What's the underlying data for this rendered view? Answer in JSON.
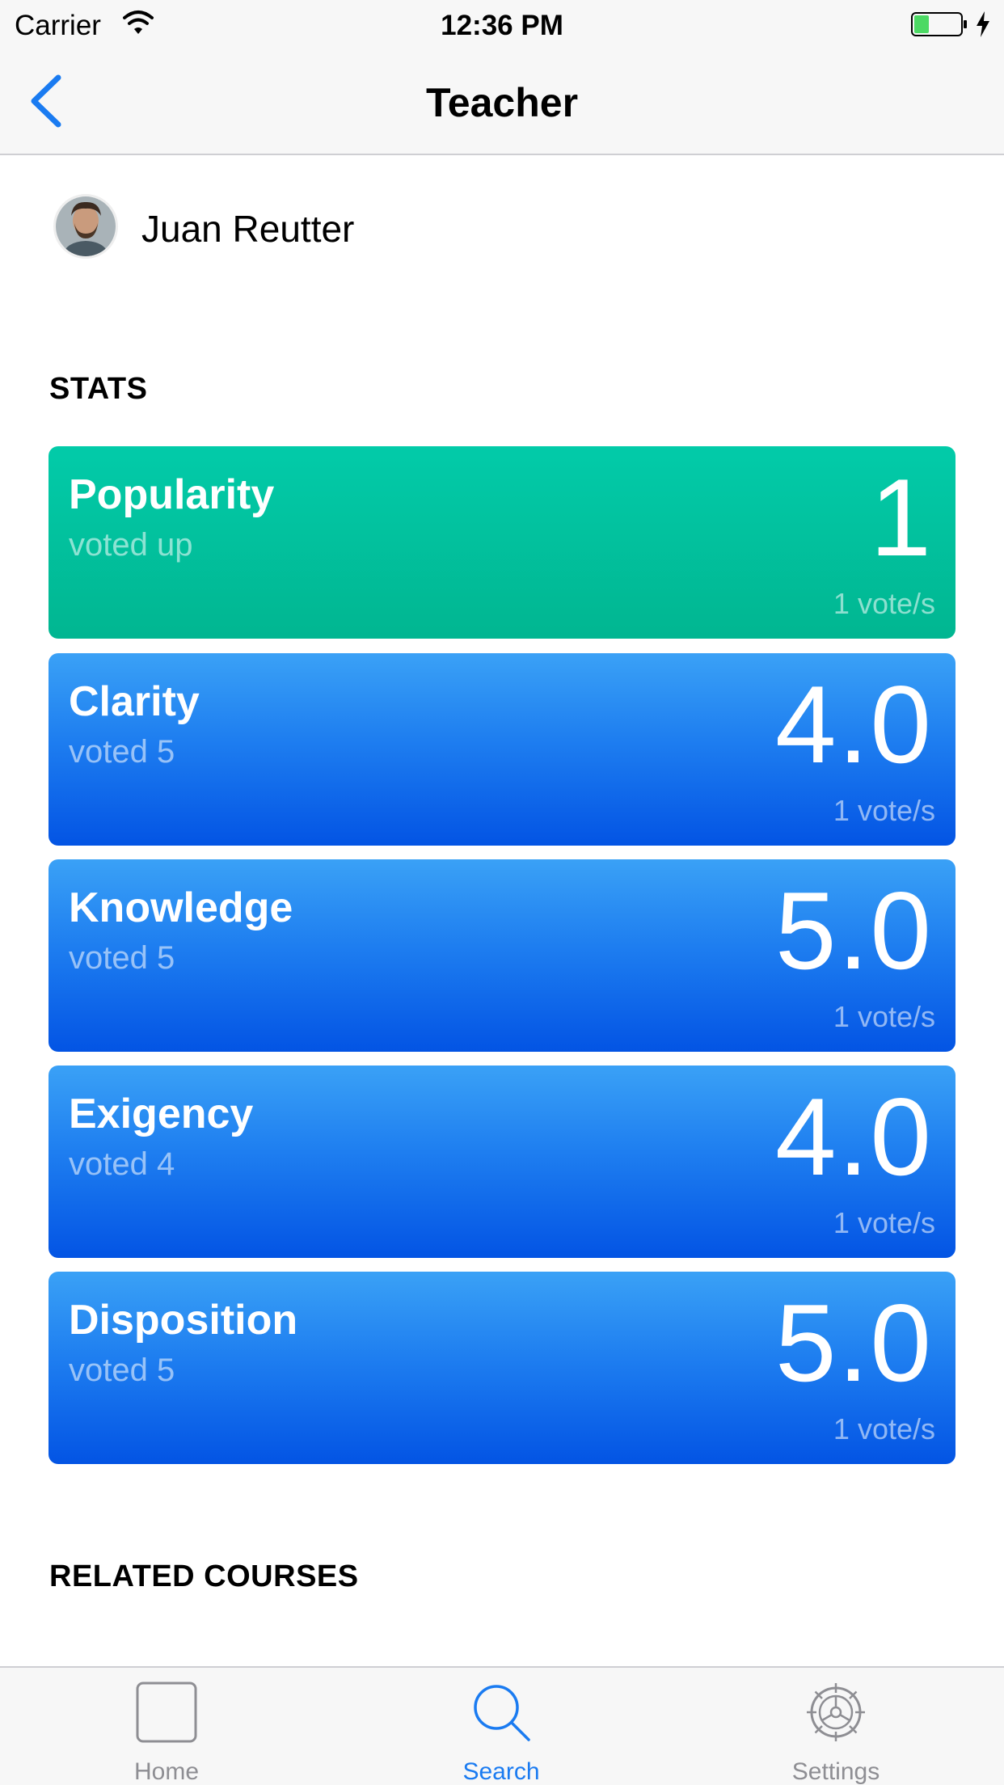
{
  "status_bar": {
    "carrier": "Carrier",
    "time": "12:36 PM",
    "battery_color": "#4cd964"
  },
  "nav": {
    "title": "Teacher",
    "back_icon": "chevron-left-icon",
    "tint": "#1a7bf1"
  },
  "profile": {
    "name": "Juan Reutter"
  },
  "stats": {
    "section_title": "STATS",
    "cards": [
      {
        "name": "Popularity",
        "sub": "voted up",
        "value": "1",
        "votes": "1 vote/s",
        "color": "#02c4a3"
      },
      {
        "name": "Clarity",
        "sub": "voted 5",
        "value": "4.0",
        "votes": "1 vote/s",
        "color": "#1e7ef0"
      },
      {
        "name": "Knowledge",
        "sub": "voted 5",
        "value": "5.0",
        "votes": "1 vote/s",
        "color": "#1e7ef0"
      },
      {
        "name": "Exigency",
        "sub": "voted 4",
        "value": "4.0",
        "votes": "1 vote/s",
        "color": "#1e7ef0"
      },
      {
        "name": "Disposition",
        "sub": "voted 5",
        "value": "5.0",
        "votes": "1 vote/s",
        "color": "#1e7ef0"
      }
    ]
  },
  "related_courses": {
    "section_title": "RELATED COURSES"
  },
  "tab_bar": {
    "tabs": [
      {
        "label": "Home",
        "icon": "home-icon",
        "active": false
      },
      {
        "label": "Search",
        "icon": "search-icon",
        "active": true
      },
      {
        "label": "Settings",
        "icon": "gear-icon",
        "active": false
      }
    ]
  }
}
